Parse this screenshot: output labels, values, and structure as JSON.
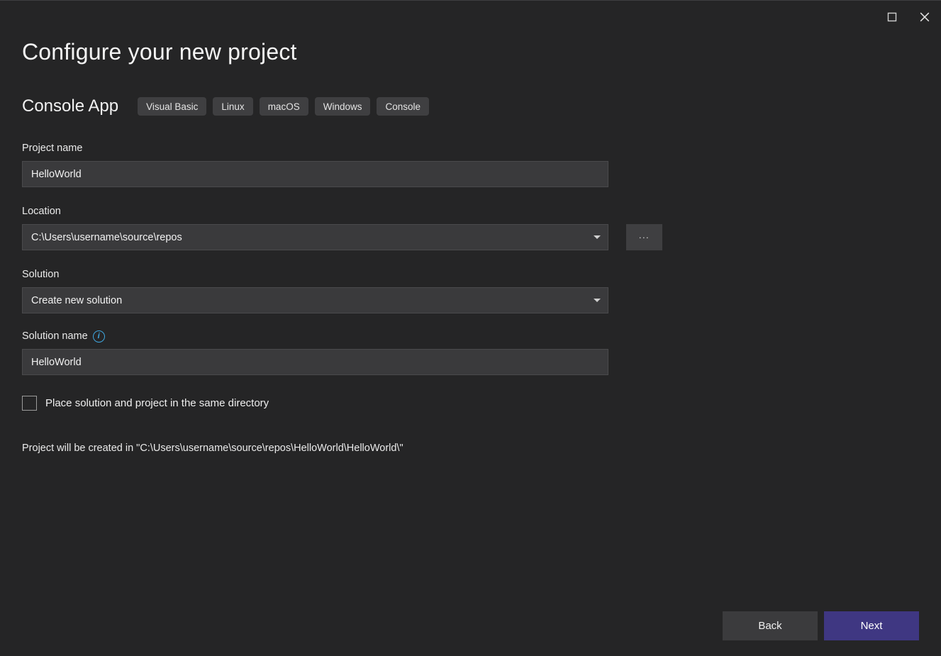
{
  "window": {
    "maximize_label": "Maximize",
    "close_label": "Close"
  },
  "header": {
    "title": "Configure your new project",
    "template_name": "Console App",
    "tags": [
      {
        "label": "Visual Basic"
      },
      {
        "label": "Linux"
      },
      {
        "label": "macOS"
      },
      {
        "label": "Windows"
      },
      {
        "label": "Console"
      }
    ]
  },
  "form": {
    "project_name": {
      "label": "Project name",
      "value": "HelloWorld",
      "placeholder": "Project name"
    },
    "location": {
      "label": "Location",
      "value": "C:\\Users\\username\\source\\repos",
      "browse_label": "..."
    },
    "solution": {
      "label": "Solution",
      "value": "Create new solution"
    },
    "solution_name": {
      "label": "Solution name",
      "info_icon_glyph": "i",
      "value": "HelloWorld",
      "placeholder": "Solution name"
    },
    "same_directory_checkbox": {
      "label": "Place solution and project in the same directory",
      "checked": false
    },
    "created_in_text": "Project will be created in \"C:\\Users\\username\\source\\repos\\HelloWorld\\HelloWorld\\\""
  },
  "footer": {
    "back_label": "Back",
    "next_label": "Next"
  },
  "colors": {
    "background": "#252526",
    "field": "#3a3a3c",
    "field_border": "#4a4a4c",
    "tag": "#3f3f41",
    "accent_primary": "#3f3782",
    "info_blue": "#3fa7e0",
    "text": "#f0f0f0"
  }
}
